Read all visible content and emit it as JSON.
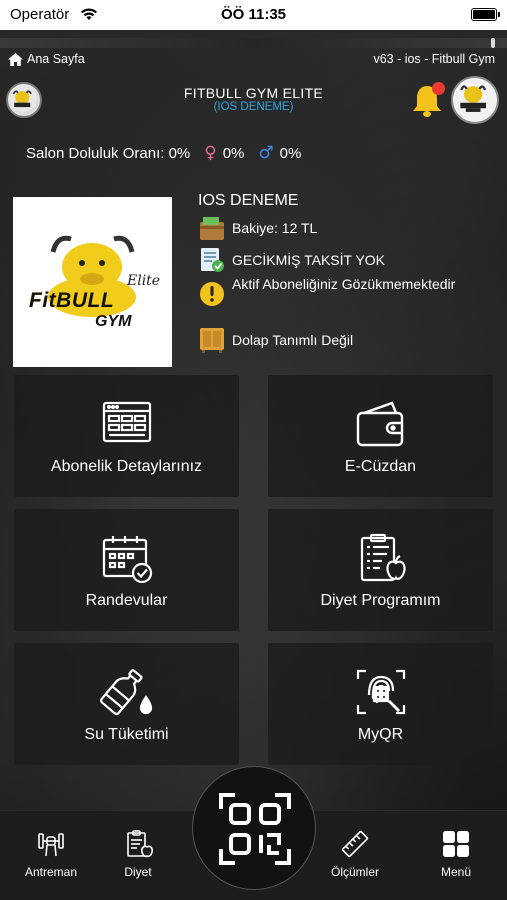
{
  "status_bar": {
    "carrier": "Operatör",
    "time": "ÖÖ 11:35"
  },
  "breadcrumb": {
    "home_label": "Ana Sayfa"
  },
  "version": "v63 - ios -  Fitbull Gym",
  "header": {
    "title": "FITBULL GYM ELITE",
    "subtitle": "(IOS DENEME)"
  },
  "occupancy": {
    "label": "Salon Doluluk Oranı: 0%",
    "female": "0%",
    "male": "0%"
  },
  "profile": {
    "name": "IOS DENEME",
    "logo": {
      "word1": "FitBULL",
      "word2": "GYM",
      "tag": "Elite"
    },
    "balance": "Bakiye: 12 TL",
    "installment": "GECİKMİŞ TAKSİT YOK",
    "subscription": "Aktif Aboneliğiniz Gözükmemektedir",
    "locker": "Dolap Tanımlı Değil"
  },
  "tiles": [
    {
      "label": "Abonelik Detaylarınız",
      "icon": "browser-icon"
    },
    {
      "label": "E-Cüzdan",
      "icon": "wallet-icon"
    },
    {
      "label": "Randevular",
      "icon": "calendar-check-icon"
    },
    {
      "label": "Diyet Programım",
      "icon": "clipboard-apple-icon"
    },
    {
      "label": "Su Tüketimi",
      "icon": "water-bottle-icon"
    },
    {
      "label": "MyQR",
      "icon": "fingerprint-scan-icon"
    }
  ],
  "bottom_nav": [
    {
      "label": "Antreman",
      "icon": "dumbbell-icon"
    },
    {
      "label": "Diyet",
      "icon": "clipboard-icon"
    },
    {
      "label": "Ölçümler",
      "icon": "ruler-icon"
    },
    {
      "label": "Menü",
      "icon": "grid-icon"
    }
  ],
  "colors": {
    "accent_blue": "#2ea7e0",
    "bell_yellow": "#f4c21c",
    "badge_red": "#ea3b2e",
    "female": "#e76c9c",
    "male": "#3d8ef0"
  }
}
